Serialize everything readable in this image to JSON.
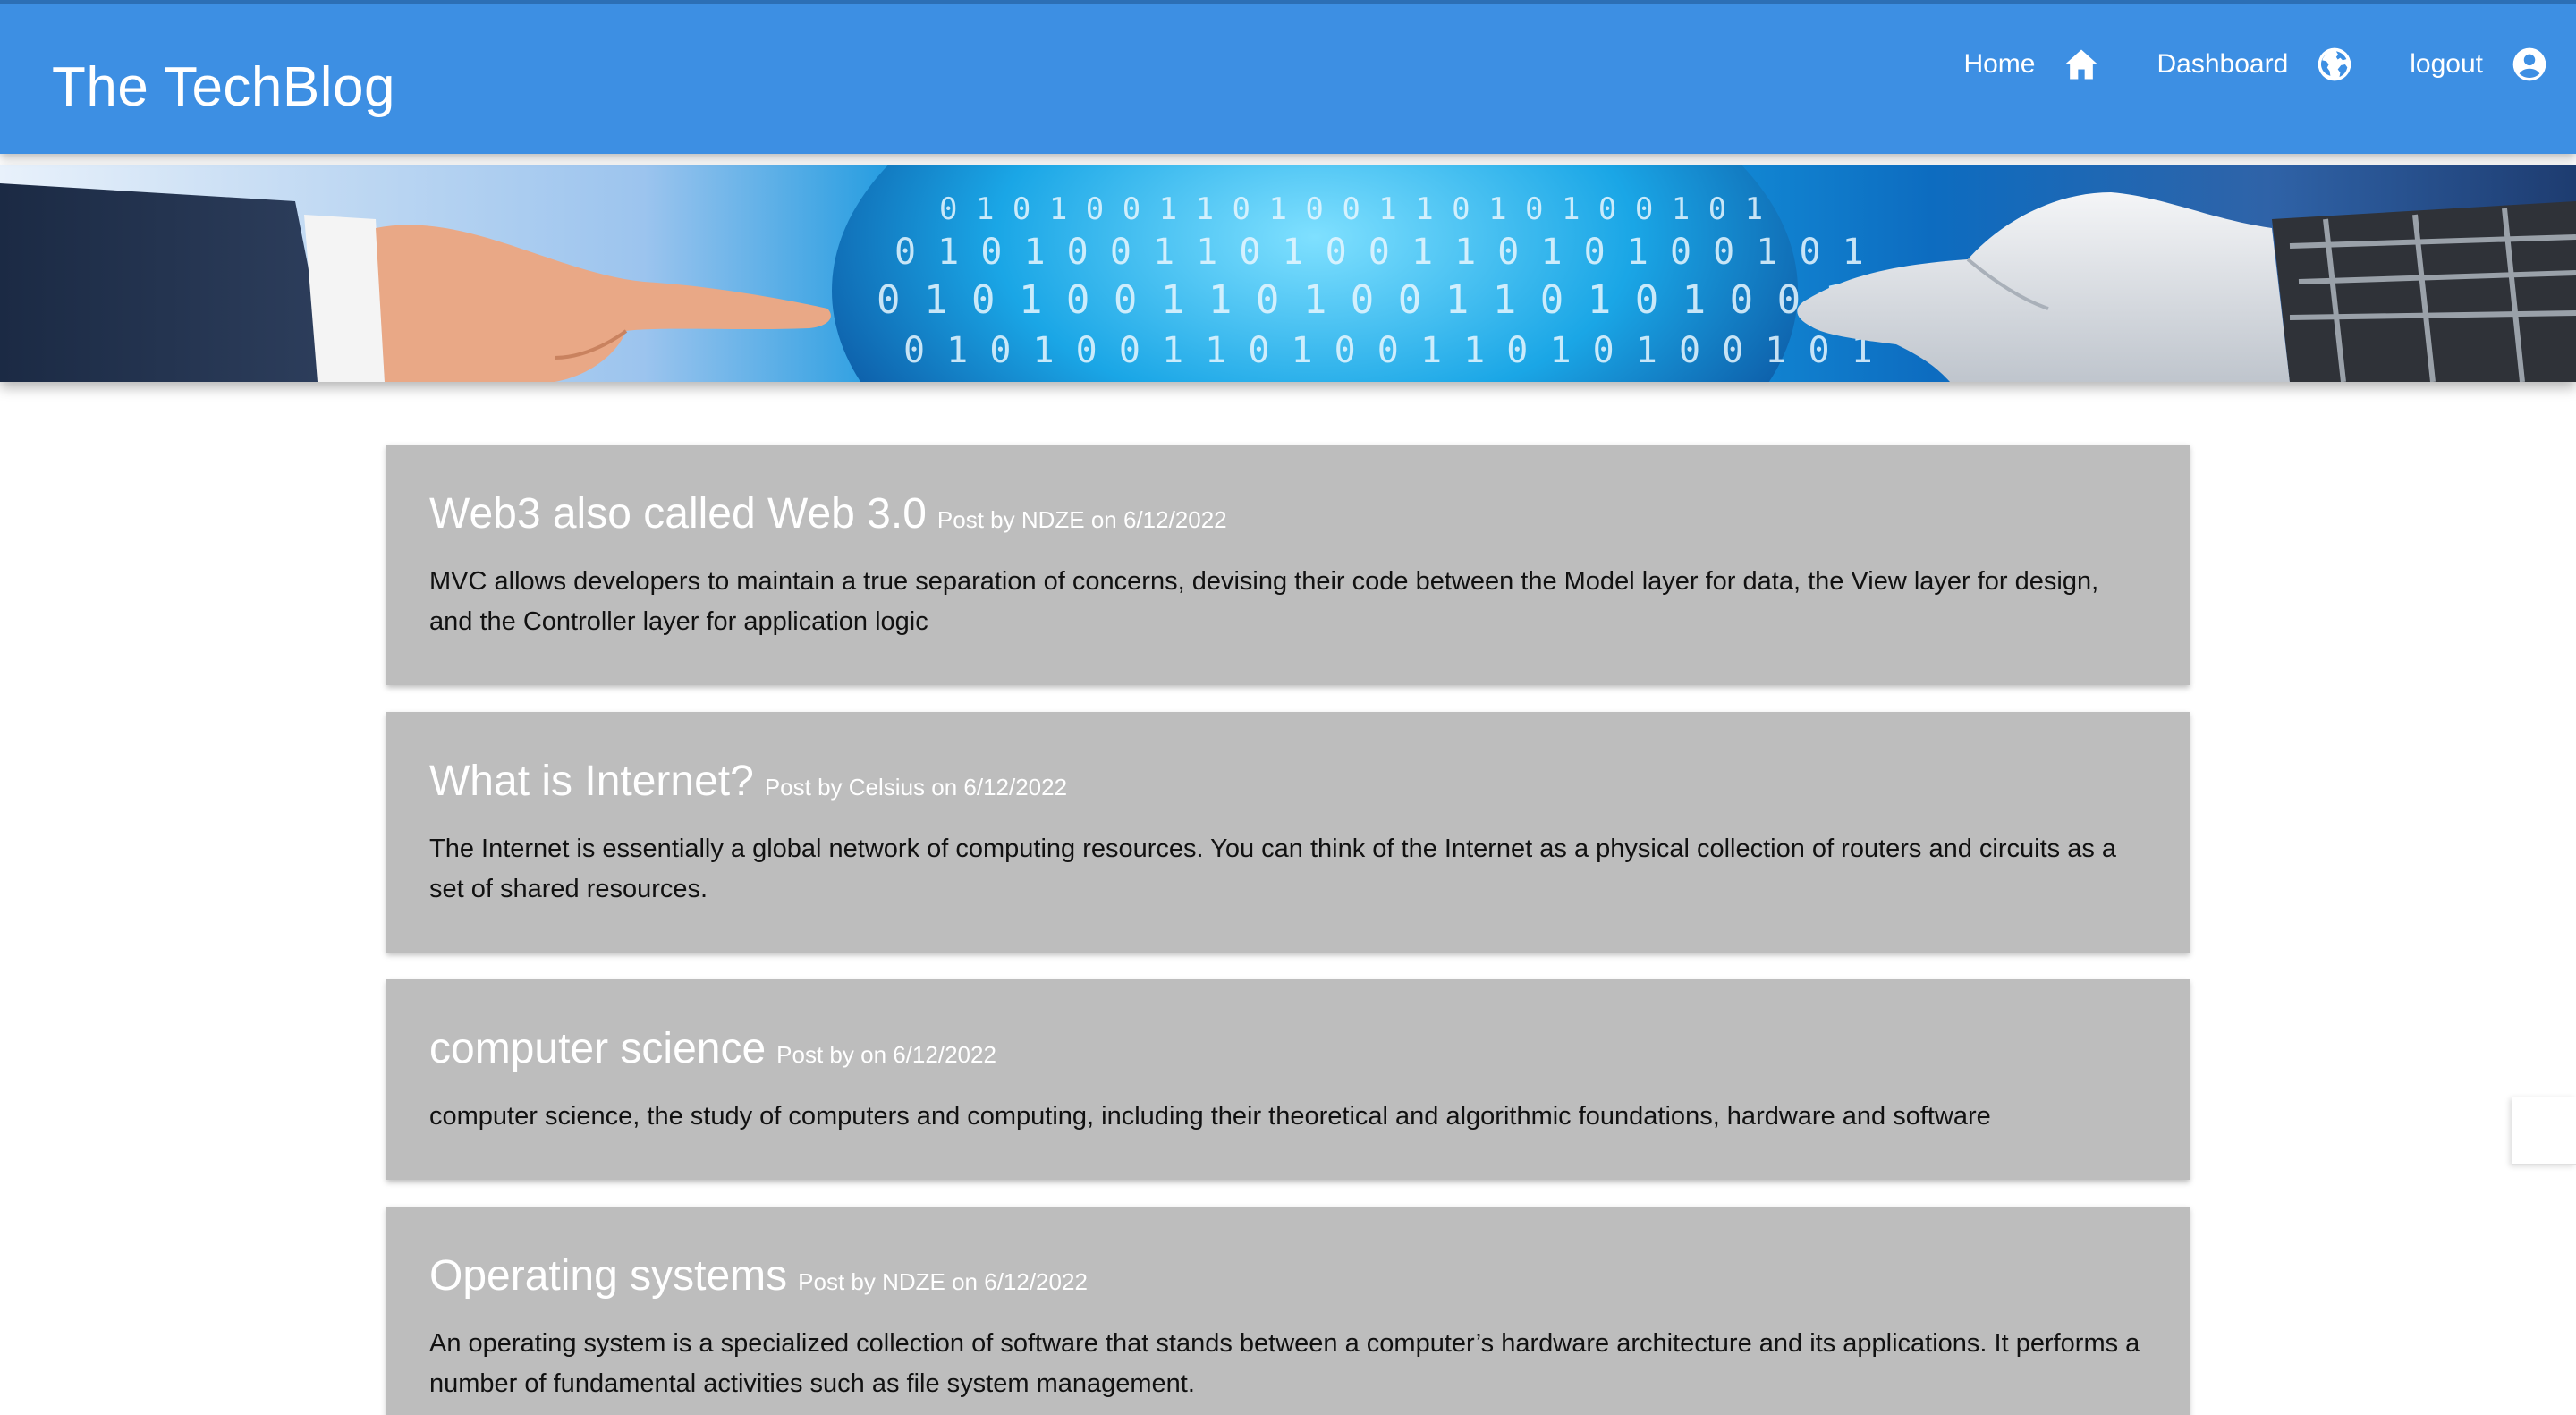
{
  "header": {
    "brand": "The TechBlog",
    "nav": [
      {
        "label": "Home",
        "icon": "home-icon"
      },
      {
        "label": "Dashboard",
        "icon": "globe-icon"
      },
      {
        "label": "logout",
        "icon": "account-circle-icon"
      }
    ]
  },
  "banner": {
    "binary_digits": "0 1 0 1 0 0 1 1 0 1 0 0 1 1 0 1 0 1 0 0 1 0 1"
  },
  "posts": [
    {
      "title": "Web3 also called Web 3.0",
      "meta": "Post by NDZE on 6/12/2022",
      "body": "MVC allows developers to maintain a true separation of concerns, devising their code between the Model layer for data, the View layer for design, and the Controller layer for application logic"
    },
    {
      "title": "What is Internet?",
      "meta": "Post by Celsius on 6/12/2022",
      "body": "The Internet is essentially a global network of computing resources. You can think of the Internet as a physical collection of routers and circuits as a set of shared resources."
    },
    {
      "title": "computer science",
      "meta": "Post by on 6/12/2022",
      "body": "computer science, the study of computers and computing, including their theoretical and algorithmic foundations, hardware and software"
    },
    {
      "title": "Operating systems",
      "meta": "Post by NDZE on 6/12/2022",
      "body": "An operating system is a specialized collection of software that stands between a computer’s hardware architecture and its applications. It performs a number of fundamental activities such as file system management."
    }
  ],
  "colors": {
    "header": "#3d8fe3",
    "card": "#bdbdbd",
    "text_white": "#ffffff",
    "body_text": "#111111"
  }
}
